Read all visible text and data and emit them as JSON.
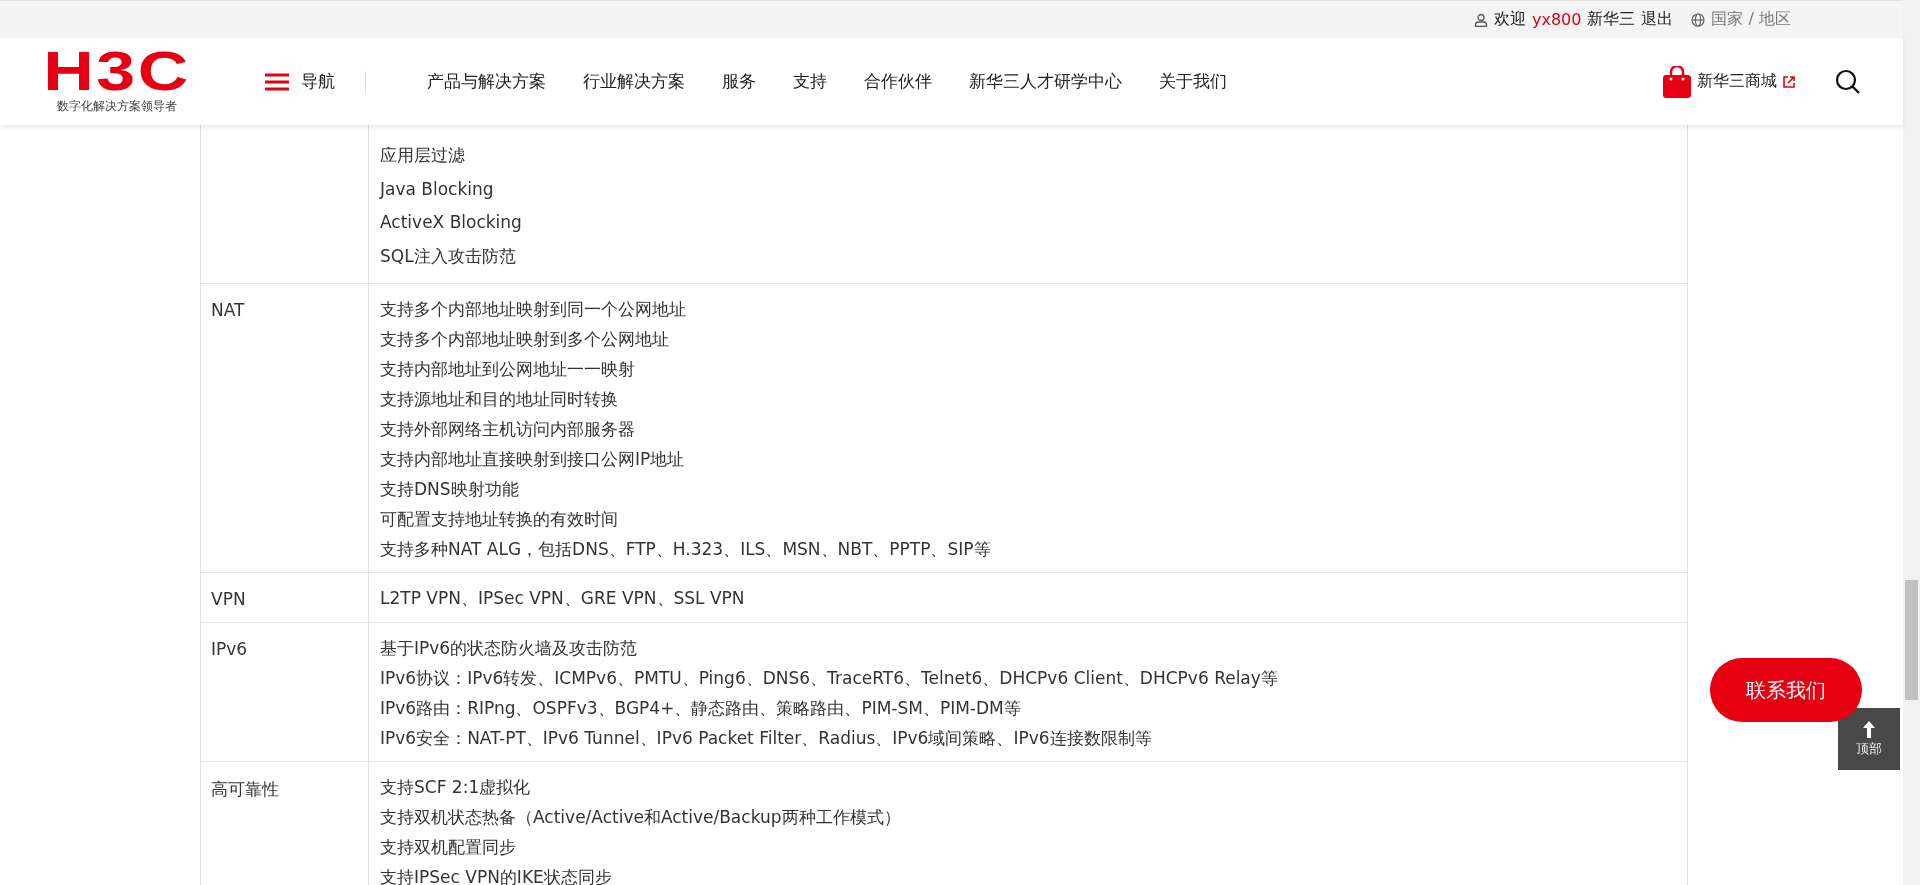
{
  "top_bar": {
    "welcome": "欢迎",
    "username": "yx800",
    "company": "新华三",
    "logout": "退出",
    "region": "国家 / 地区"
  },
  "header": {
    "logo": "H3C",
    "tagline": "数字化解决方案领导者",
    "menu_label": "导航",
    "nav": [
      "产品与解决方案",
      "行业解决方案",
      "服务",
      "支持",
      "合作伙伴",
      "新华三人才研学中心",
      "关于我们"
    ],
    "shop": "新华三商城"
  },
  "table": {
    "rows": [
      {
        "lines": [
          "应用层过滤",
          "Java Blocking",
          "ActiveX Blocking",
          "SQL注入攻击防范"
        ]
      },
      {
        "label": "NAT",
        "lines": [
          "支持多个内部地址映射到同一个公网地址",
          "支持多个内部地址映射到多个公网地址",
          "支持内部地址到公网地址一一映射",
          "支持源地址和目的地址同时转换",
          "支持外部网络主机访问内部服务器",
          "支持内部地址直接映射到接口公网IP地址",
          "支持DNS映射功能",
          "可配置支持地址转换的有效时间",
          "支持多种NAT ALG，包括DNS、FTP、H.323、ILS、MSN、NBT、PPTP、SIP等"
        ]
      },
      {
        "label": "VPN",
        "lines": [
          "L2TP VPN、IPSec VPN、GRE VPN、SSL VPN"
        ]
      },
      {
        "label": "IPv6",
        "lines": [
          "基于IPv6的状态防火墙及攻击防范",
          "IPv6协议：IPv6转发、ICMPv6、PMTU、Ping6、DNS6、TraceRT6、Telnet6、DHCPv6 Client、DHCPv6 Relay等",
          "IPv6路由：RIPng、OSPFv3、BGP4+、静态路由、策略路由、PIM-SM、PIM-DM等",
          "IPv6安全：NAT-PT、IPv6 Tunnel、IPv6 Packet Filter、Radius、IPv6域间策略、IPv6连接数限制等"
        ]
      },
      {
        "label": "高可靠性",
        "lines": [
          "支持SCF 2:1虚拟化",
          "支持双机状态热备（Active/Active和Active/Backup两种工作模式）",
          "支持双机配置同步",
          "支持IPSec VPN的IKE状态同步"
        ]
      }
    ]
  },
  "contact_button": "联系我们",
  "top_button": "顶部"
}
